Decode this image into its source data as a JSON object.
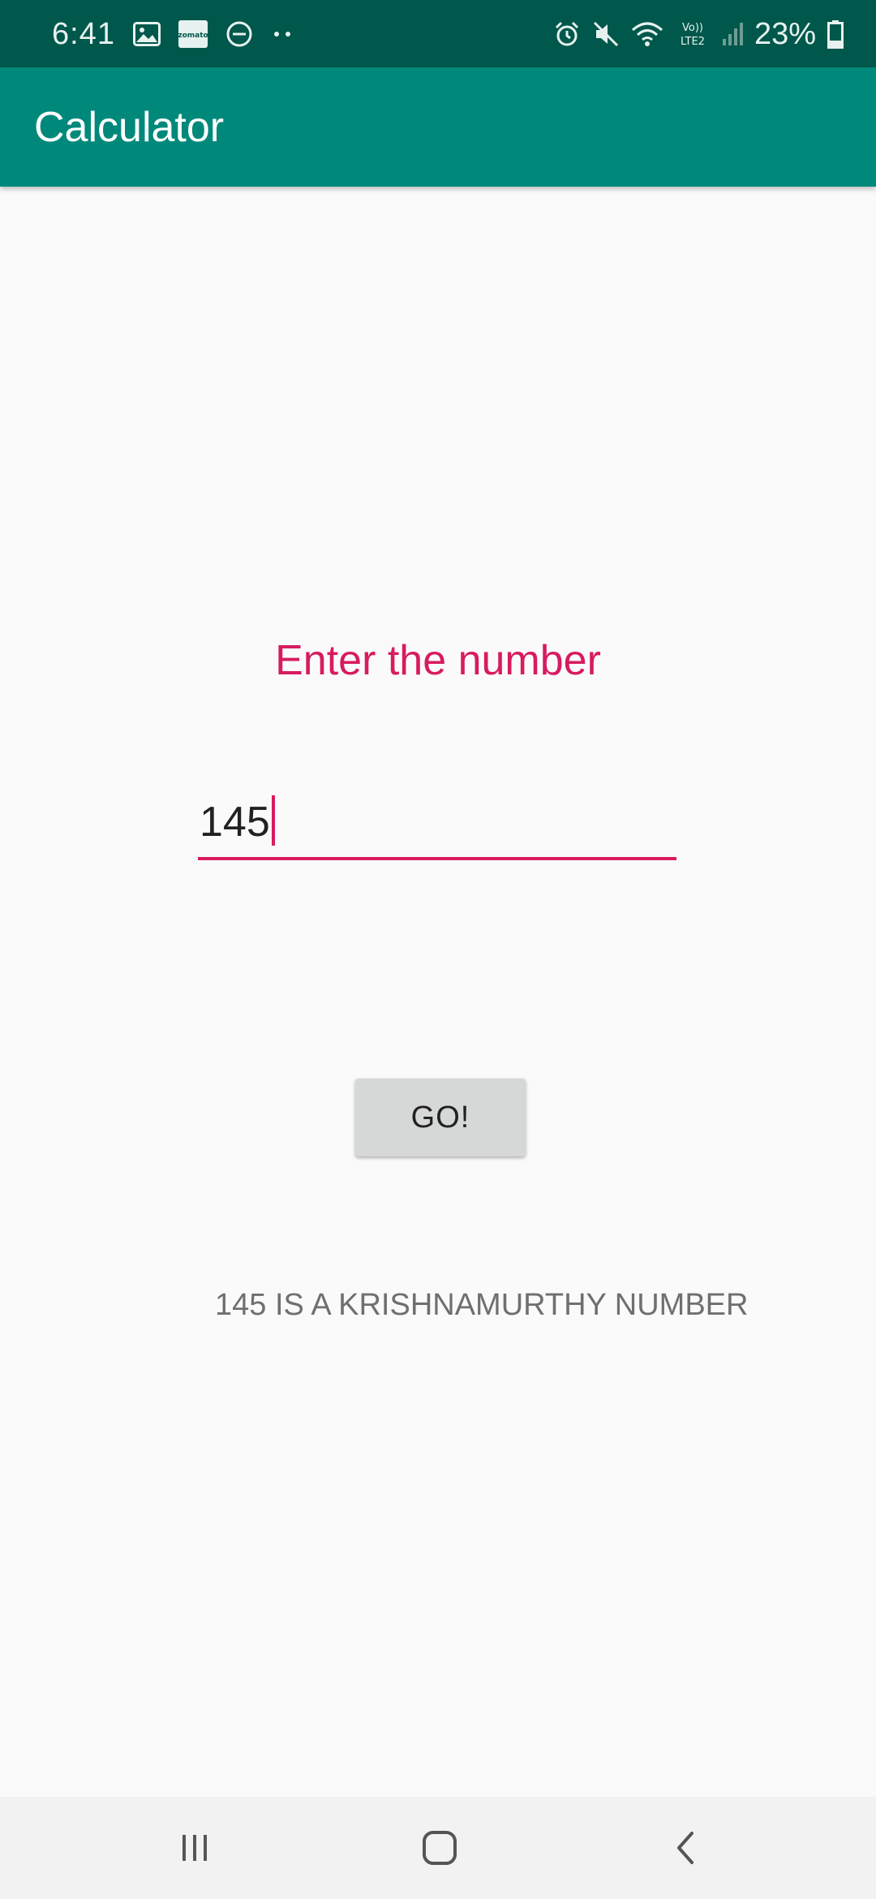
{
  "status_bar": {
    "time": "6:41",
    "battery_percent": "23%",
    "left_icons": [
      "gallery-icon",
      "zomato-notification-icon",
      "do-not-disturb-icon",
      "more-notifications-icon"
    ],
    "right_icons": [
      "alarm-icon",
      "mute-icon",
      "wifi-icon",
      "volte-lte2-icon",
      "signal-icon",
      "battery-icon"
    ],
    "zomato_label": "zomato",
    "volte_label": "Vo))",
    "lte_label": "LTE2"
  },
  "app_bar": {
    "title": "Calculator"
  },
  "main": {
    "prompt": "Enter the number",
    "input_value": "145",
    "go_button_label": "GO!",
    "result_text": "145 IS A KRISHNAMURTHY NUMBER"
  },
  "nav_bar": {
    "buttons": [
      "recent-apps",
      "home",
      "back"
    ]
  },
  "colors": {
    "status_bar": "#00574b",
    "app_bar": "#00897b",
    "accent": "#d81b60",
    "button_bg": "#d6d7d7",
    "background": "#fafafa",
    "result_text": "#6f6f6f"
  }
}
